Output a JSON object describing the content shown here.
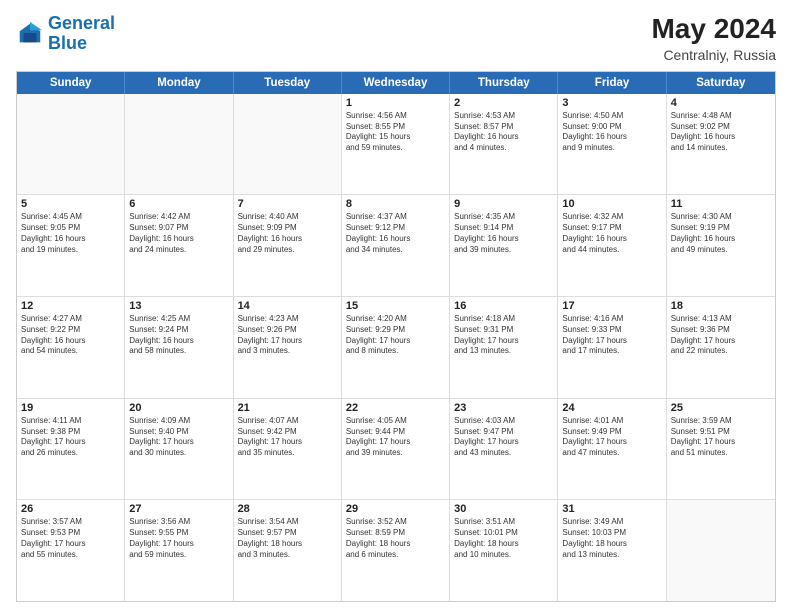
{
  "header": {
    "logo_general": "General",
    "logo_blue": "Blue",
    "month_year": "May 2024",
    "location": "Centralniy, Russia"
  },
  "days_of_week": [
    "Sunday",
    "Monday",
    "Tuesday",
    "Wednesday",
    "Thursday",
    "Friday",
    "Saturday"
  ],
  "weeks": [
    [
      {
        "day": "",
        "info": ""
      },
      {
        "day": "",
        "info": ""
      },
      {
        "day": "",
        "info": ""
      },
      {
        "day": "1",
        "info": "Sunrise: 4:56 AM\nSunset: 8:55 PM\nDaylight: 15 hours\nand 59 minutes."
      },
      {
        "day": "2",
        "info": "Sunrise: 4:53 AM\nSunset: 8:57 PM\nDaylight: 16 hours\nand 4 minutes."
      },
      {
        "day": "3",
        "info": "Sunrise: 4:50 AM\nSunset: 9:00 PM\nDaylight: 16 hours\nand 9 minutes."
      },
      {
        "day": "4",
        "info": "Sunrise: 4:48 AM\nSunset: 9:02 PM\nDaylight: 16 hours\nand 14 minutes."
      }
    ],
    [
      {
        "day": "5",
        "info": "Sunrise: 4:45 AM\nSunset: 9:05 PM\nDaylight: 16 hours\nand 19 minutes."
      },
      {
        "day": "6",
        "info": "Sunrise: 4:42 AM\nSunset: 9:07 PM\nDaylight: 16 hours\nand 24 minutes."
      },
      {
        "day": "7",
        "info": "Sunrise: 4:40 AM\nSunset: 9:09 PM\nDaylight: 16 hours\nand 29 minutes."
      },
      {
        "day": "8",
        "info": "Sunrise: 4:37 AM\nSunset: 9:12 PM\nDaylight: 16 hours\nand 34 minutes."
      },
      {
        "day": "9",
        "info": "Sunrise: 4:35 AM\nSunset: 9:14 PM\nDaylight: 16 hours\nand 39 minutes."
      },
      {
        "day": "10",
        "info": "Sunrise: 4:32 AM\nSunset: 9:17 PM\nDaylight: 16 hours\nand 44 minutes."
      },
      {
        "day": "11",
        "info": "Sunrise: 4:30 AM\nSunset: 9:19 PM\nDaylight: 16 hours\nand 49 minutes."
      }
    ],
    [
      {
        "day": "12",
        "info": "Sunrise: 4:27 AM\nSunset: 9:22 PM\nDaylight: 16 hours\nand 54 minutes."
      },
      {
        "day": "13",
        "info": "Sunrise: 4:25 AM\nSunset: 9:24 PM\nDaylight: 16 hours\nand 58 minutes."
      },
      {
        "day": "14",
        "info": "Sunrise: 4:23 AM\nSunset: 9:26 PM\nDaylight: 17 hours\nand 3 minutes."
      },
      {
        "day": "15",
        "info": "Sunrise: 4:20 AM\nSunset: 9:29 PM\nDaylight: 17 hours\nand 8 minutes."
      },
      {
        "day": "16",
        "info": "Sunrise: 4:18 AM\nSunset: 9:31 PM\nDaylight: 17 hours\nand 13 minutes."
      },
      {
        "day": "17",
        "info": "Sunrise: 4:16 AM\nSunset: 9:33 PM\nDaylight: 17 hours\nand 17 minutes."
      },
      {
        "day": "18",
        "info": "Sunrise: 4:13 AM\nSunset: 9:36 PM\nDaylight: 17 hours\nand 22 minutes."
      }
    ],
    [
      {
        "day": "19",
        "info": "Sunrise: 4:11 AM\nSunset: 9:38 PM\nDaylight: 17 hours\nand 26 minutes."
      },
      {
        "day": "20",
        "info": "Sunrise: 4:09 AM\nSunset: 9:40 PM\nDaylight: 17 hours\nand 30 minutes."
      },
      {
        "day": "21",
        "info": "Sunrise: 4:07 AM\nSunset: 9:42 PM\nDaylight: 17 hours\nand 35 minutes."
      },
      {
        "day": "22",
        "info": "Sunrise: 4:05 AM\nSunset: 9:44 PM\nDaylight: 17 hours\nand 39 minutes."
      },
      {
        "day": "23",
        "info": "Sunrise: 4:03 AM\nSunset: 9:47 PM\nDaylight: 17 hours\nand 43 minutes."
      },
      {
        "day": "24",
        "info": "Sunrise: 4:01 AM\nSunset: 9:49 PM\nDaylight: 17 hours\nand 47 minutes."
      },
      {
        "day": "25",
        "info": "Sunrise: 3:59 AM\nSunset: 9:51 PM\nDaylight: 17 hours\nand 51 minutes."
      }
    ],
    [
      {
        "day": "26",
        "info": "Sunrise: 3:57 AM\nSunset: 9:53 PM\nDaylight: 17 hours\nand 55 minutes."
      },
      {
        "day": "27",
        "info": "Sunrise: 3:56 AM\nSunset: 9:55 PM\nDaylight: 17 hours\nand 59 minutes."
      },
      {
        "day": "28",
        "info": "Sunrise: 3:54 AM\nSunset: 9:57 PM\nDaylight: 18 hours\nand 3 minutes."
      },
      {
        "day": "29",
        "info": "Sunrise: 3:52 AM\nSunset: 8:59 PM\nDaylight: 18 hours\nand 6 minutes."
      },
      {
        "day": "30",
        "info": "Sunrise: 3:51 AM\nSunset: 10:01 PM\nDaylight: 18 hours\nand 10 minutes."
      },
      {
        "day": "31",
        "info": "Sunrise: 3:49 AM\nSunset: 10:03 PM\nDaylight: 18 hours\nand 13 minutes."
      },
      {
        "day": "",
        "info": ""
      }
    ]
  ]
}
